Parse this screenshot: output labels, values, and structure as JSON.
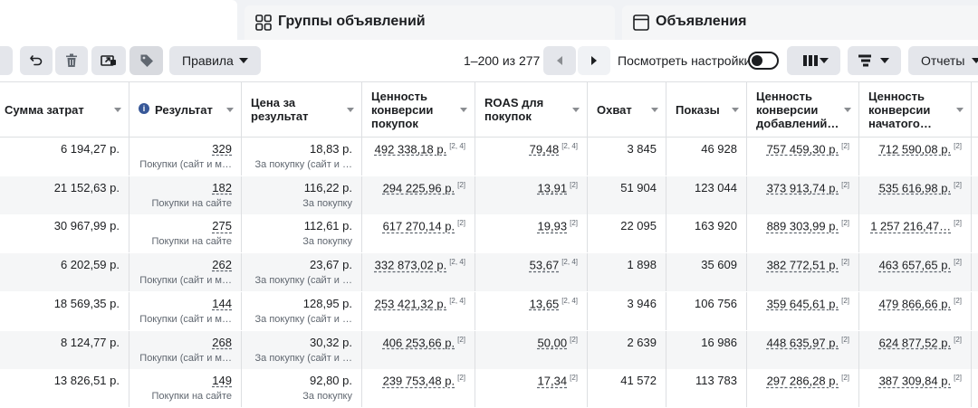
{
  "tabs": [
    {
      "label": ""
    },
    {
      "label": "Группы объявлений",
      "icon": "grid-icon"
    },
    {
      "label": "Объявления",
      "icon": "window-icon"
    }
  ],
  "toolbar": {
    "rules_label": "Правила",
    "pagination": "1–200 из 277",
    "view_settings_label": "Посмотреть настройки",
    "view_settings_on": false,
    "reports_label": "Отчеты"
  },
  "columns": [
    {
      "label": "Сумма затрат"
    },
    {
      "label": "Результат",
      "info": true
    },
    {
      "label": "Цена за результат"
    },
    {
      "label": "Ценность конверсии покупок"
    },
    {
      "label": "ROAS для покупок"
    },
    {
      "label": "Охват"
    },
    {
      "label": "Показы"
    },
    {
      "label": "Ценность конверсии добавлений…"
    },
    {
      "label": "Ценность конверсии начатого…"
    }
  ],
  "rows": [
    {
      "spend": "6 194,27 р.",
      "result": "329",
      "result_sub": "Покупки (сайт и м…",
      "cpr": "18,83 р.",
      "cpr_sub": "За покупку (сайт и …",
      "purchase_value": "492 338,18 р.",
      "purchase_value_sup": "[2, 4]",
      "roas": "79,48",
      "roas_sup": "[2, 4]",
      "reach": "3 845",
      "impressions": "46 928",
      "add_value": "757 459,30 р.",
      "add_value_sup": "[2]",
      "checkout_value": "712 590,08 р.",
      "checkout_value_sup": "[2]"
    },
    {
      "spend": "21 152,63 р.",
      "result": "182",
      "result_sub": "Покупки на сайте",
      "cpr": "116,22 р.",
      "cpr_sub": "За покупку",
      "purchase_value": "294 225,96 р.",
      "purchase_value_sup": "[2]",
      "roas": "13,91",
      "roas_sup": "[2]",
      "reach": "51 904",
      "impressions": "123 044",
      "add_value": "373 913,74 р.",
      "add_value_sup": "[2]",
      "checkout_value": "535 616,98 р.",
      "checkout_value_sup": "[2]"
    },
    {
      "spend": "30 967,99 р.",
      "result": "275",
      "result_sub": "Покупки на сайте",
      "cpr": "112,61 р.",
      "cpr_sub": "За покупку",
      "purchase_value": "617 270,14 р.",
      "purchase_value_sup": "[2]",
      "roas": "19,93",
      "roas_sup": "[2]",
      "reach": "22 095",
      "impressions": "163 920",
      "add_value": "889 303,99 р.",
      "add_value_sup": "[2]",
      "checkout_value": "1 257 216,47…",
      "checkout_value_sup": "[2]"
    },
    {
      "spend": "6 202,59 р.",
      "result": "262",
      "result_sub": "Покупки (сайт и м…",
      "cpr": "23,67 р.",
      "cpr_sub": "За покупку (сайт и …",
      "purchase_value": "332 873,02 р.",
      "purchase_value_sup": "[2, 4]",
      "roas": "53,67",
      "roas_sup": "[2, 4]",
      "reach": "1 898",
      "impressions": "35 609",
      "add_value": "382 772,51 р.",
      "add_value_sup": "[2]",
      "checkout_value": "463 657,65 р.",
      "checkout_value_sup": "[2]"
    },
    {
      "spend": "18 569,35 р.",
      "result": "144",
      "result_sub": "Покупки (сайт и м…",
      "cpr": "128,95 р.",
      "cpr_sub": "За покупку (сайт и …",
      "purchase_value": "253 421,32 р.",
      "purchase_value_sup": "[2, 4]",
      "roas": "13,65",
      "roas_sup": "[2, 4]",
      "reach": "3 946",
      "impressions": "106 756",
      "add_value": "359 645,61 р.",
      "add_value_sup": "[2]",
      "checkout_value": "479 866,66 р.",
      "checkout_value_sup": "[2]"
    },
    {
      "spend": "8 124,77 р.",
      "result": "268",
      "result_sub": "Покупки (сайт и м…",
      "cpr": "30,32 р.",
      "cpr_sub": "За покупку (сайт и …",
      "purchase_value": "406 253,66 р.",
      "purchase_value_sup": "[2]",
      "roas": "50,00",
      "roas_sup": "[2]",
      "reach": "2 639",
      "impressions": "16 986",
      "add_value": "448 635,97 р.",
      "add_value_sup": "[2]",
      "checkout_value": "624 877,52 р.",
      "checkout_value_sup": "[2]"
    },
    {
      "spend": "13 826,51 р.",
      "result": "149",
      "result_sub": "Покупки на сайте",
      "cpr": "92,80 р.",
      "cpr_sub": "За покупку",
      "purchase_value": "239 753,48 р.",
      "purchase_value_sup": "[2]",
      "roas": "17,34",
      "roas_sup": "[2]",
      "reach": "41 572",
      "impressions": "113 783",
      "add_value": "297 286,28 р.",
      "add_value_sup": "[2]",
      "checkout_value": "387 309,84 р.",
      "checkout_value_sup": "[2]"
    }
  ]
}
